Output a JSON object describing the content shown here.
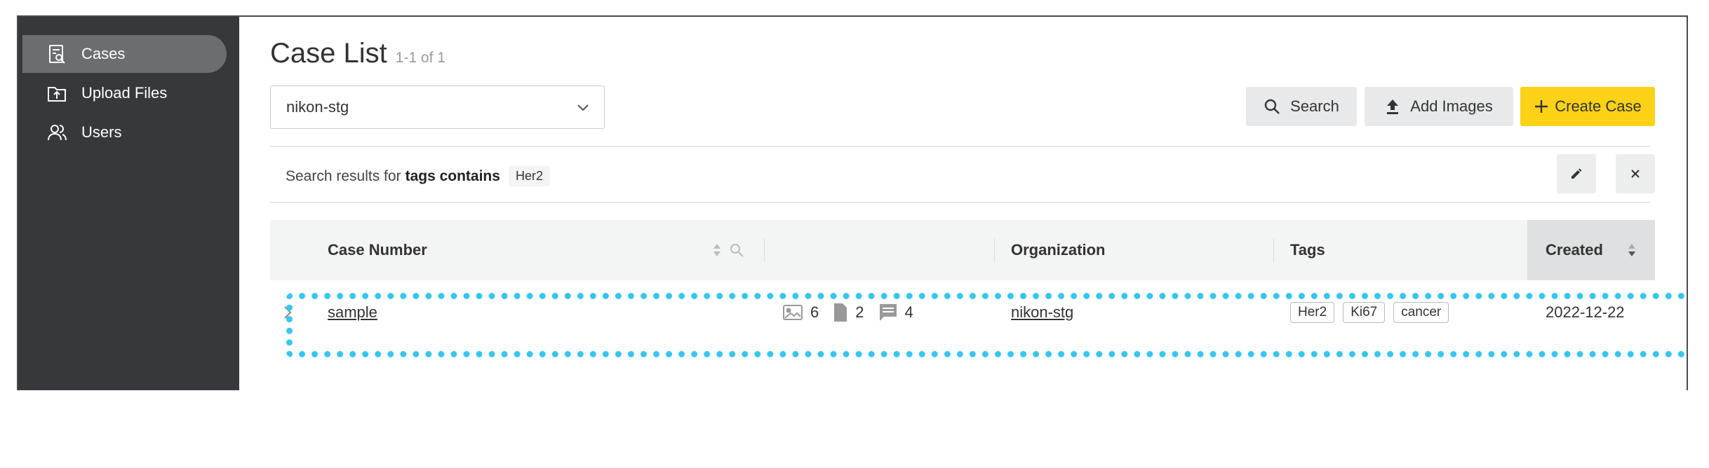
{
  "sidebar": {
    "items": [
      {
        "label": "Cases",
        "icon": "cases-icon",
        "active": true
      },
      {
        "label": "Upload Files",
        "icon": "upload-files-icon",
        "active": false
      },
      {
        "label": "Users",
        "icon": "users-icon",
        "active": false
      }
    ]
  },
  "page": {
    "title": "Case List",
    "count": "1-1 of 1"
  },
  "org_select": {
    "value": "nikon-stg"
  },
  "toolbar": {
    "search_label": "Search",
    "add_images_label": "Add Images",
    "create_case_label": "Create Case"
  },
  "filter": {
    "prefix": "Search results for",
    "condition": "tags contains",
    "value": "Her2"
  },
  "table": {
    "columns": {
      "case_number": "Case Number",
      "organization": "Organization",
      "tags": "Tags",
      "created": "Created"
    },
    "rows": [
      {
        "case_number": "sample",
        "images": "6",
        "files": "2",
        "comments": "4",
        "organization": "nikon-stg",
        "tags": [
          "Her2",
          "Ki67",
          "cancer"
        ],
        "created": "2022-12-22"
      }
    ]
  },
  "colors": {
    "sidebar_bg": "#35393c",
    "sidebar_active": "#6a6e71",
    "create_button": "#fcd116",
    "highlight_outline": "#38c6ef"
  }
}
